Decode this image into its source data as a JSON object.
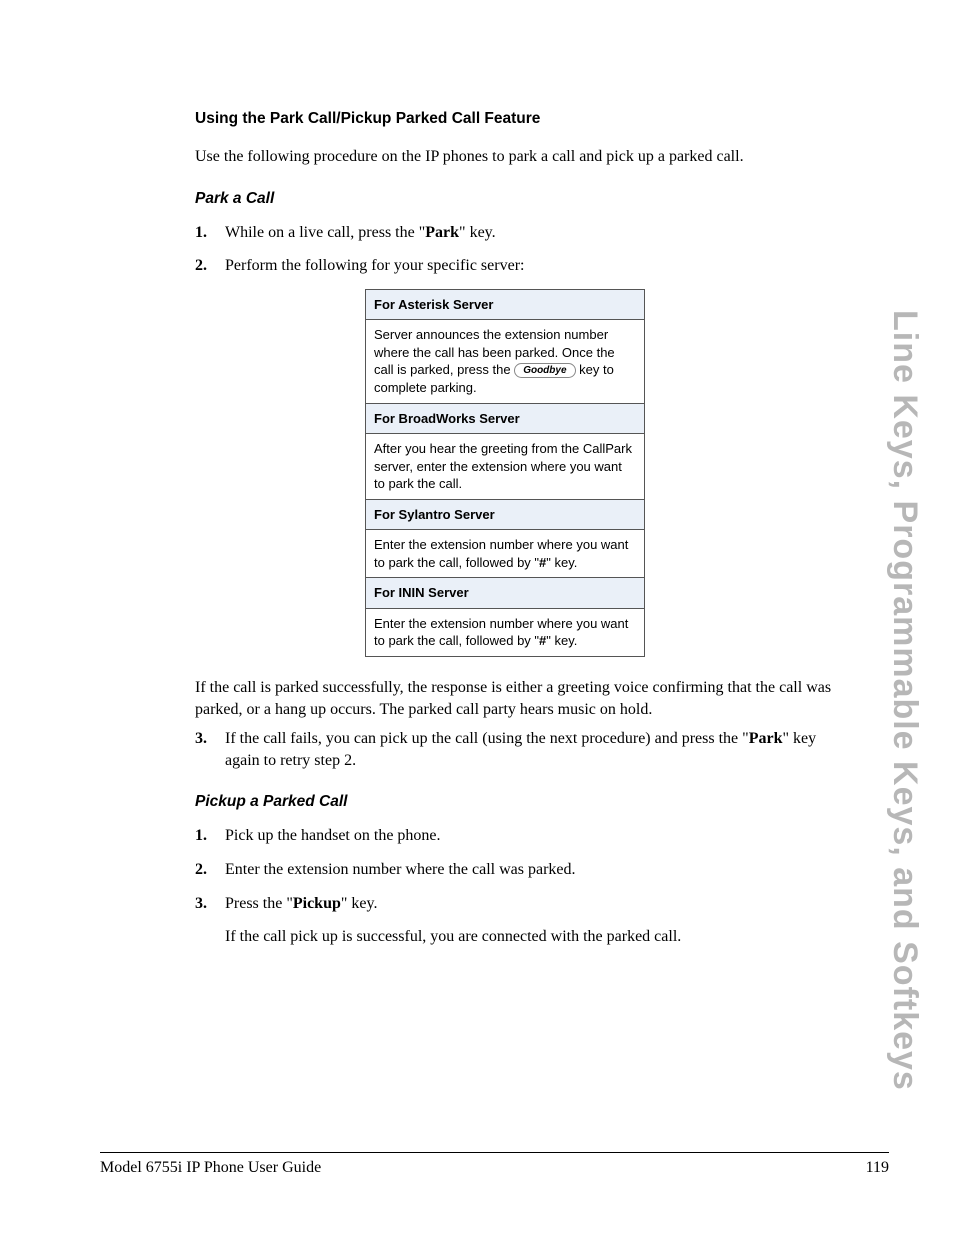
{
  "side_title": "Line Keys, Programmable Keys, and Softkeys",
  "h1": "Using the Park Call/Pickup Parked Call Feature",
  "intro": "Use the following procedure on the IP phones to park a call and pick up a parked call.",
  "park": {
    "heading": "Park a Call",
    "step1_a": "While on a live call, press the \"",
    "step1_b": "Park",
    "step1_c": "\" key.",
    "step2": "Perform the following for your specific server:",
    "after_table": "If the call is parked successfully, the response is either a greeting voice confirming that the call was parked, or a hang up occurs. The parked call party hears music on hold.",
    "step3_a": "If the call fails, you can pick up the call (using the next procedure) and press the \"",
    "step3_b": "Park",
    "step3_c": "\" key again to retry step 2."
  },
  "table": {
    "asterisk_h": "For Asterisk Server",
    "asterisk_pre": "Server announces the extension number where the call has been parked. Once the call is parked, press the ",
    "asterisk_btn": "Goodbye",
    "asterisk_post": " key to complete parking.",
    "broadworks_h": "For BroadWorks Server",
    "broadworks_c": " After you hear the greeting from the CallPark server, enter the extension where you want to park the call.",
    "sylantro_h": "For Sylantro Server",
    "sylantro_pre": "Enter the extension number where you want to park the call, followed by \"",
    "sylantro_key": "#",
    "sylantro_post": "\" key.",
    "inin_h": "For ININ Server",
    "inin_pre": "Enter the extension number where you want to park the call, followed by \"",
    "inin_key": "#",
    "inin_post": "\" key."
  },
  "pickup": {
    "heading": "Pickup a Parked Call",
    "s1": "Pick up the handset on the phone.",
    "s2": "Enter the extension number where the call was parked.",
    "s3_a": "Press the \"",
    "s3_b": "Pickup",
    "s3_c": "\" key.",
    "result": "If the call pick up is successful, you are connected with the parked call."
  },
  "footer": {
    "left": "Model 6755i IP Phone User Guide",
    "right": "119"
  }
}
